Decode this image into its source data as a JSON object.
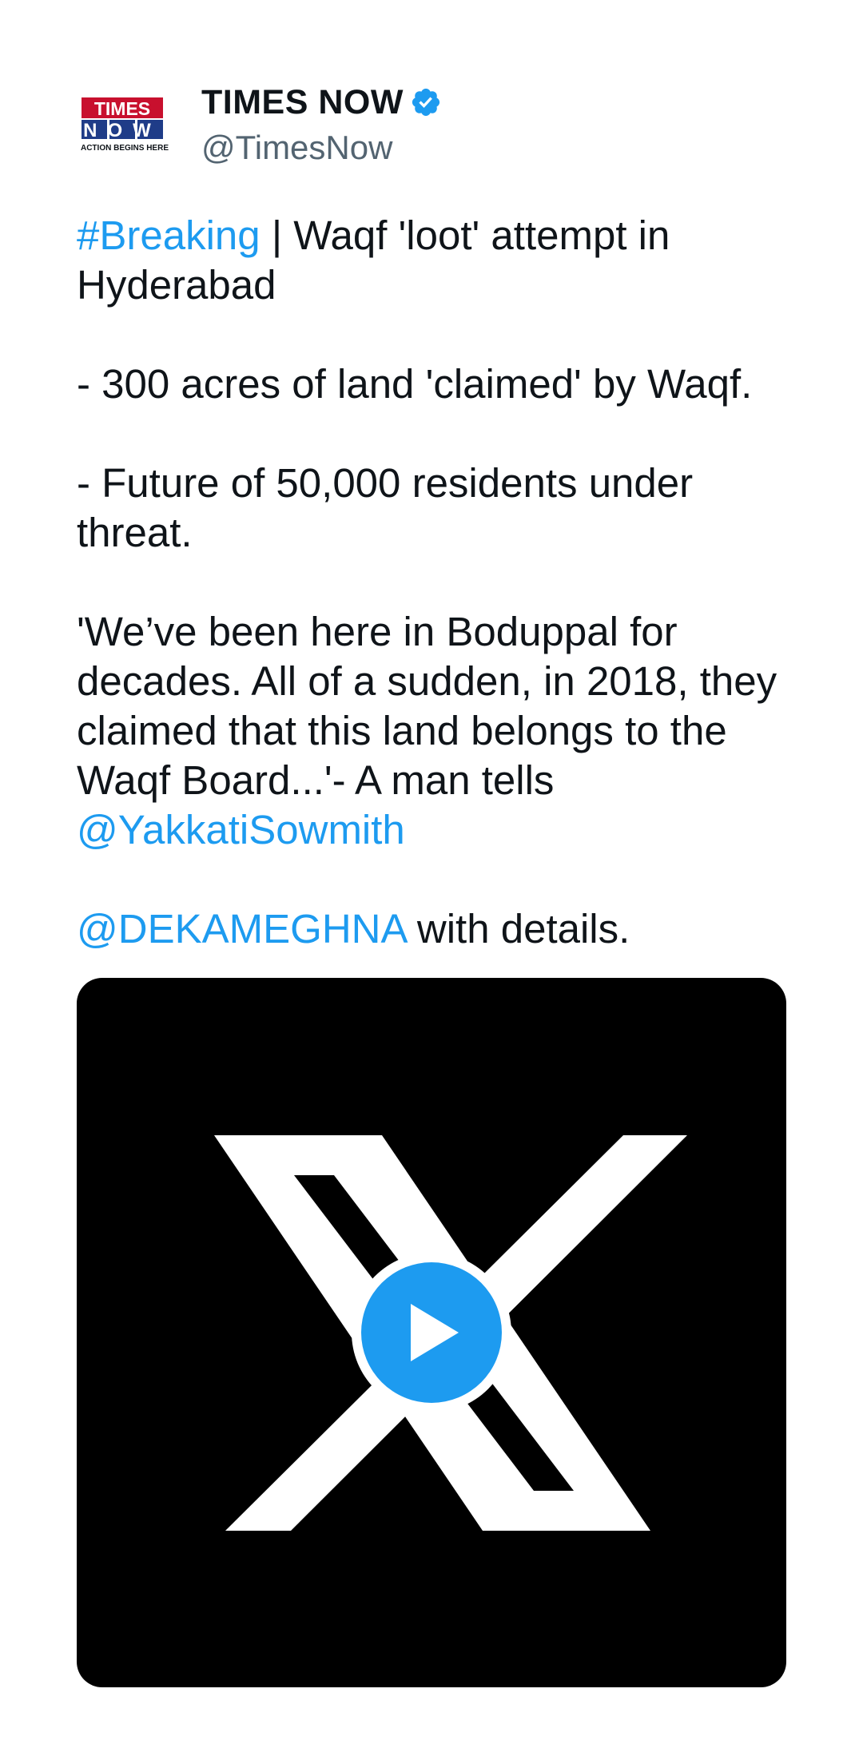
{
  "author": {
    "display_name": "TIMES NOW",
    "handle": "@TimesNow",
    "verified": true,
    "avatar": {
      "line1": "TIMES",
      "line2": "NOW",
      "tagline": "ACTION BEGINS HERE"
    }
  },
  "tweet": {
    "hashtag": "#Breaking",
    "headline_rest": " | Waqf 'loot' attempt in Hyderabad",
    "point1": "- 300 acres of land 'claimed' by Waqf.",
    "point2": "- Future of 50,000 residents under threat.",
    "quote": "'We’ve been here in Boduppal for decades. All of a sudden, in 2018, they claimed that this land belongs to the Waqf Board...'- A man tells ",
    "mention1": "@YakkatiSowmith",
    "mention2": "@DEKAMEGHNA",
    "closing": " with details."
  },
  "media": {
    "type": "video",
    "placeholder_icon": "x-logo-icon",
    "play_icon": "play-icon"
  },
  "colors": {
    "link": "#1d9bf0",
    "text": "#0f1419",
    "handle": "#536471",
    "verified": "#1d9bf0",
    "media_bg": "#000000"
  }
}
